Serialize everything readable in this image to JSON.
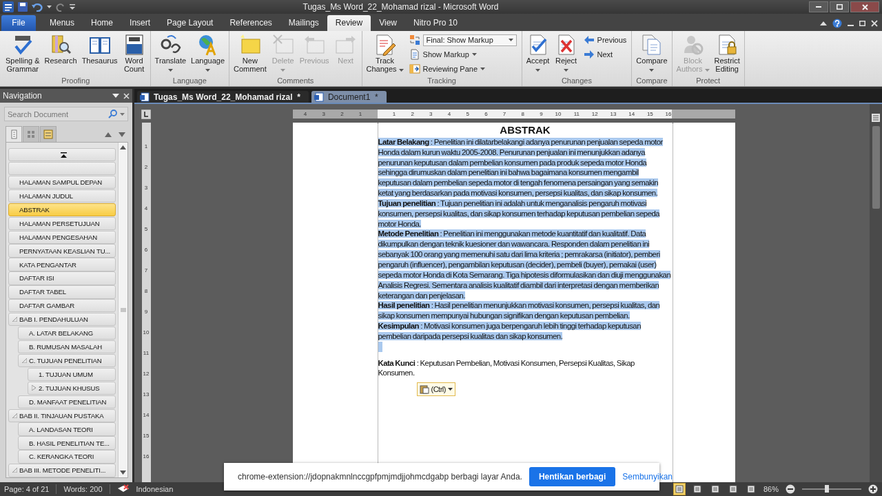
{
  "title_bar": {
    "title": "Tugas_Ms Word_22_Mohamad rizal  -  Microsoft Word"
  },
  "ribbon_tabs": [
    {
      "label": "File",
      "kind": "file",
      "selected": false
    },
    {
      "label": "Menus",
      "kind": "tab",
      "selected": false
    },
    {
      "label": "Home",
      "kind": "tab",
      "selected": false
    },
    {
      "label": "Insert",
      "kind": "tab",
      "selected": false
    },
    {
      "label": "Page Layout",
      "kind": "tab",
      "selected": false
    },
    {
      "label": "References",
      "kind": "tab",
      "selected": false
    },
    {
      "label": "Mailings",
      "kind": "tab",
      "selected": false
    },
    {
      "label": "Review",
      "kind": "tab",
      "selected": true
    },
    {
      "label": "View",
      "kind": "tab",
      "selected": false
    },
    {
      "label": "Nitro Pro 10",
      "kind": "tab",
      "selected": false
    }
  ],
  "ribbon_groups": [
    {
      "label": "Proofing",
      "buttons": [
        {
          "kind": "large",
          "label": "Spelling &\nGrammar",
          "disabled": false,
          "dropdown": false
        },
        {
          "kind": "large",
          "label": "Research",
          "disabled": false,
          "dropdown": false
        },
        {
          "kind": "large",
          "label": "Thesaurus",
          "disabled": false,
          "dropdown": false
        },
        {
          "kind": "large",
          "label": "Word\nCount",
          "disabled": false,
          "dropdown": false
        }
      ]
    },
    {
      "label": "Language",
      "buttons": [
        {
          "kind": "large",
          "label": "Translate",
          "disabled": false,
          "dropdown": true
        },
        {
          "kind": "large",
          "label": "Language",
          "disabled": false,
          "dropdown": true
        }
      ]
    },
    {
      "label": "Comments",
      "buttons": [
        {
          "kind": "large",
          "label": "New\nComment",
          "disabled": false,
          "dropdown": false
        },
        {
          "kind": "large",
          "label": "Delete",
          "disabled": true,
          "dropdown": true
        },
        {
          "kind": "large",
          "label": "Previous",
          "disabled": true,
          "dropdown": false
        },
        {
          "kind": "large",
          "label": "Next",
          "disabled": true,
          "dropdown": false
        }
      ]
    },
    {
      "label": "Tracking",
      "buttons": [
        {
          "kind": "large",
          "label": "Track\nChanges",
          "disabled": false,
          "dropdown": true
        },
        {
          "kind": "combo",
          "label": "Final: Show Markup",
          "disabled": false,
          "dropdown": true
        },
        {
          "kind": "small",
          "label": "Show Markup",
          "disabled": false,
          "dropdown": true
        },
        {
          "kind": "small",
          "label": "Reviewing Pane",
          "disabled": false,
          "dropdown": true
        }
      ]
    },
    {
      "label": "Changes",
      "buttons": [
        {
          "kind": "large",
          "label": "Accept",
          "disabled": false,
          "dropdown": true
        },
        {
          "kind": "large",
          "label": "Reject",
          "disabled": false,
          "dropdown": true
        },
        {
          "kind": "small",
          "label": "Previous",
          "disabled": false,
          "dropdown": false
        },
        {
          "kind": "small",
          "label": "Next",
          "disabled": false,
          "dropdown": false
        }
      ]
    },
    {
      "label": "Compare",
      "buttons": [
        {
          "kind": "large",
          "label": "Compare",
          "disabled": false,
          "dropdown": true
        }
      ]
    },
    {
      "label": "Protect",
      "buttons": [
        {
          "kind": "large",
          "label": "Block\nAuthors",
          "disabled": true,
          "dropdown": true
        },
        {
          "kind": "large",
          "label": "Restrict\nEditing",
          "disabled": false,
          "dropdown": false
        }
      ]
    }
  ],
  "navigation": {
    "title": "Navigation",
    "search": {
      "placeholder": "Search Document"
    },
    "view_tabs": [
      {
        "selected": true
      },
      {
        "selected": false
      },
      {
        "selected": false
      }
    ],
    "headings": [
      {
        "label": "HALAMAN SAMPUL DEPAN",
        "selected": false
      },
      {
        "label": "HALAMAN JUDUL",
        "selected": false
      },
      {
        "label": "ABSTRAK",
        "selected": true
      },
      {
        "label": "HALAMAN PERSETUJUAN",
        "selected": false
      },
      {
        "label": "HALAMAN PENGESAHAN",
        "selected": false
      },
      {
        "label": "PERNYATAAN KEASLIAN TU...",
        "selected": false
      },
      {
        "label": "KATA PENGANTAR",
        "selected": false
      },
      {
        "label": "DAFTAR ISI",
        "selected": false
      },
      {
        "label": "DAFTAR TABEL",
        "selected": false
      },
      {
        "label": "DAFTAR GAMBAR",
        "selected": false
      },
      {
        "label": "BAB I.  PENDAHULUAN",
        "selected": false,
        "expanded": true,
        "children": [
          {
            "label": "A. LATAR BELAKANG",
            "selected": false
          },
          {
            "label": "B. RUMUSAN MASALAH",
            "selected": false
          },
          {
            "label": "C. TUJUAN PENELITIAN",
            "selected": false,
            "expanded": true,
            "children": [
              {
                "label": "1. TUJUAN UMUM",
                "selected": false
              },
              {
                "label": "2. TUJUAN KHUSUS",
                "selected": false,
                "expanded": false
              }
            ]
          },
          {
            "label": "D. MANFAAT PENELITIAN",
            "selected": false
          }
        ]
      },
      {
        "label": "BAB II.  TINJAUAN PUSTAKA",
        "selected": false,
        "expanded": true,
        "children": [
          {
            "label": "A. LANDASAN TEORI",
            "selected": false
          },
          {
            "label": "B. HASIL PENELITIAN TE...",
            "selected": false
          },
          {
            "label": "C. KERANGKA TEORI",
            "selected": false
          }
        ]
      },
      {
        "label": "BAB III.  METODE PENELITI...",
        "selected": false,
        "expanded": true
      }
    ]
  },
  "document_tabs": [
    {
      "label": "Tugas_Ms Word_22_Mohamad rizal  *",
      "selected": true
    },
    {
      "label": "Document1  *",
      "selected": false
    }
  ],
  "ruler": {
    "left_labels": [
      "4",
      "3",
      "2",
      "1"
    ],
    "labels": [
      "1",
      "2",
      "3",
      "4",
      "5",
      "6",
      "7",
      "8",
      "9",
      "10",
      "11",
      "12",
      "13",
      "14",
      "15",
      "16"
    ]
  },
  "vertical_ruler": {
    "labels": [
      "1",
      "2",
      "3",
      "4",
      "5",
      "6",
      "7",
      "8",
      "9",
      "10",
      "11",
      "12",
      "13",
      "14",
      "15",
      "16"
    ]
  },
  "document": {
    "title": "ABSTRAK",
    "paragraphs": [
      {
        "text": "**Latar Belakang** : Penelitian ini dilatarbelakangi  adanya penurunan  penjualan sepeda motor Honda dalam kurun waktu 2005-2008.  Penurunan penjualan  ini menunjukkan adanya penurunan  keputusan dalam pembelian konsumen pada produk sepeda motor Honda sehingga dirumuskan dalam penelitian ini bahwa bagaimana konsumen mengambil keputusan dalam pembelian sepeda motor di tengah fenomena persaingan yang semakin ketat yang berdasarkan pada motivasi konsumen, persepsi kualitas, dan sikap konsumen.",
        "selected": true
      },
      {
        "text": "**Tujuan penelitian** : Tujuan penelitian ini adalah untuk menganalisis pengaruh motivasi konsumen, persepsi kualitas, dan sikap konsumen terhadap keputusan pembelian sepeda motor Honda.",
        "selected": true
      },
      {
        "text": "**Metode Penelitian** : Penelitian ini menggunakan metode kuantitatif dan kualitatif. Data dikumpulkan dengan teknik kuesioner dan wawancara. Responden dalam penelitian ini sebanyak 100 orang yang memenuhi satu dari lima kriteria ; pemrakarsa (initiator), pemberi pengaruh (influencer), pengambilan keputusan (decider), pembeli (buyer), pemakai (user) sepeda motor Honda di Kota Semarang. Tiga hipotesis diformulasikan dan diuji menggunakan Analisis Regresi. Sementara analisis kualitatif diambil dari interpretasi dengan memberikan keterangan dan penjelasan.",
        "selected": true
      },
      {
        "text": "**Hasil penelitian** : Hasil penelitian menunjukkan motivasi konsumen, persepsi kualitas, dan sikap konsumen mempunyai hubungan signifikan dengan keputusan pembelian.",
        "selected": true
      },
      {
        "text": "**Kesimpulan** : Motivasi konsumen juga berpengaruh lebih tinggi terhadap keputusan pembelian daripada persepsi kualitas dan sikap konsumen.",
        "selected": true
      },
      {
        "text": "**Kata Kunci** : Keputusan Pembelian, Motivasi Konsumen, Persepsi Kualitas, Sikap Konsumen.",
        "selected": false
      }
    ],
    "paste_options": {
      "label": "(Ctrl)"
    }
  },
  "status_bar": {
    "page": "Page: 4 of 21",
    "words": "Words: 200",
    "language": "Indonesian",
    "views": [
      {
        "selected": true
      },
      {
        "selected": false
      },
      {
        "selected": false
      },
      {
        "selected": false
      },
      {
        "selected": false
      }
    ],
    "zoom": "86%",
    "zoom_level": {
      "level": 0.42
    }
  },
  "share_bar": {
    "message": "chrome-extension://jdopnakmnlnccgpfpmjmdjjohmcdgabp berbagi layar Anda.",
    "stop_button": "Hentikan berbagi",
    "hide_link": "Sembunyikan"
  }
}
